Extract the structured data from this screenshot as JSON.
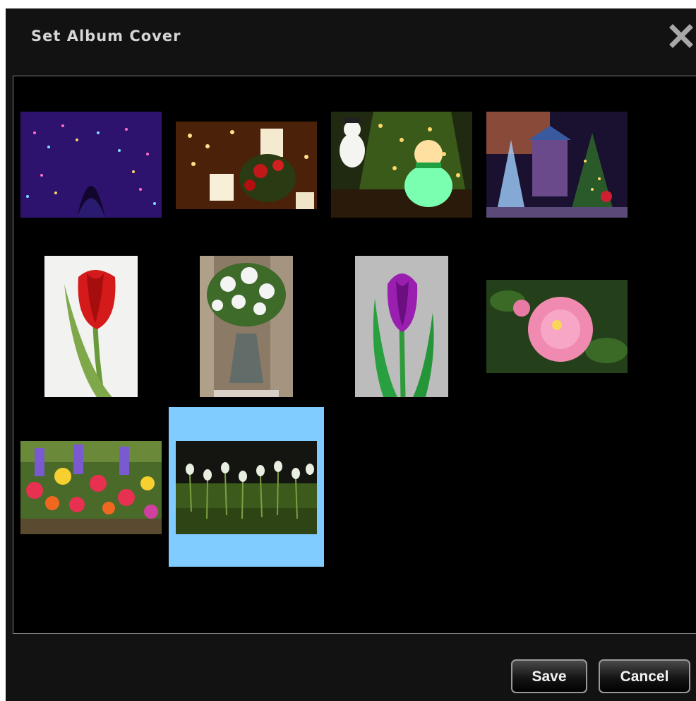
{
  "dialog": {
    "title": "Set Album Cover",
    "close_icon": "close-icon"
  },
  "gallery": {
    "selected_index": 9,
    "photos": [
      {
        "name": "photo-illumination-tunnel",
        "icon": "image-thumbnail",
        "colors": [
          "#1a0a3a",
          "#6a3fff",
          "#ff4fa0"
        ]
      },
      {
        "name": "photo-christmas-candles",
        "icon": "image-thumbnail",
        "colors": [
          "#3a1a0a",
          "#f3e6c0",
          "#b01818"
        ]
      },
      {
        "name": "photo-snowman-lights",
        "icon": "image-thumbnail",
        "colors": [
          "#2a3a10",
          "#c9c06a",
          "#66ff88"
        ]
      },
      {
        "name": "photo-christmas-house",
        "icon": "image-thumbnail",
        "colors": [
          "#1a1030",
          "#9a6ad0",
          "#3a8a3a"
        ]
      },
      {
        "name": "photo-red-tulip",
        "icon": "image-thumbnail",
        "colors": [
          "#f2f2f0",
          "#d01818",
          "#6a9a3a"
        ]
      },
      {
        "name": "photo-white-bouquet",
        "icon": "image-thumbnail",
        "colors": [
          "#8a7a6a",
          "#f4f4f4",
          "#3a6a2a"
        ]
      },
      {
        "name": "photo-purple-tulip",
        "icon": "image-thumbnail",
        "colors": [
          "#bdbdbd",
          "#8a1aa0",
          "#2e9a3a"
        ]
      },
      {
        "name": "photo-pink-camellia",
        "icon": "image-thumbnail",
        "colors": [
          "#2a4a1a",
          "#f08ab0",
          "#1a3a10"
        ]
      },
      {
        "name": "photo-primroses",
        "icon": "image-thumbnail",
        "colors": [
          "#4a6a2a",
          "#f05050",
          "#7a5ad0"
        ]
      },
      {
        "name": "photo-snowdrops",
        "icon": "image-thumbnail",
        "colors": [
          "#1a1a10",
          "#e8eee0",
          "#4a6a20"
        ]
      }
    ]
  },
  "footer": {
    "save_label": "Save",
    "cancel_label": "Cancel"
  }
}
